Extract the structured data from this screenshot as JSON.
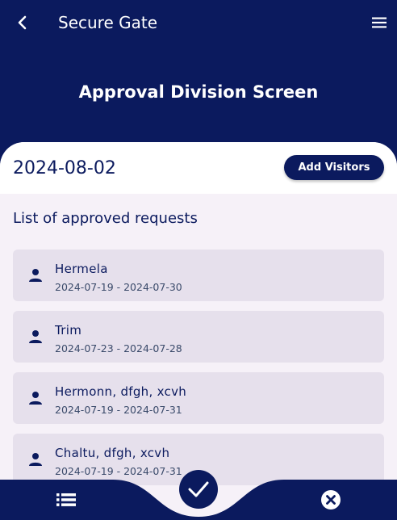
{
  "appbar": {
    "title": "Secure Gate"
  },
  "screen": {
    "title": "Approval Division Screen"
  },
  "header": {
    "date": "2024-08-02",
    "add_button_label": "Add Visitors"
  },
  "list": {
    "title": "List of approved requests",
    "items": [
      {
        "name": "Hermela",
        "dates": "2024-07-19 - 2024-07-30"
      },
      {
        "name": "Trim",
        "dates": "2024-07-23 - 2024-07-28"
      },
      {
        "name": "Hermonn, dfgh, xcvh",
        "dates": "2024-07-19 - 2024-07-31"
      },
      {
        "name": "Chaltu, dfgh, xcvh",
        "dates": "2024-07-19 - 2024-07-31"
      }
    ]
  },
  "bottom_nav": {
    "items": [
      "list-icon",
      "check-icon",
      "close-circle-icon"
    ],
    "active": "check-icon"
  },
  "colors": {
    "primary": "#0b1a5e",
    "surface": "#f6f1f8",
    "card": "#e6e0ec"
  }
}
